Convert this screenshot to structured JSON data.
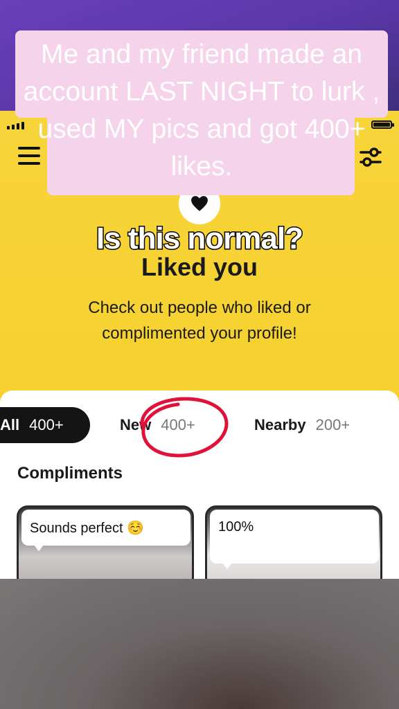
{
  "overlay": {
    "text": "Me and my friend made an account LAST NIGHT to lurk , used MY pics and got 400+ likes.",
    "caption": "Is this normal?"
  },
  "header": {
    "menu_icon": "hamburger-menu-icon",
    "filter_icon": "filter-sliders-icon",
    "badge_icon": "heart-icon"
  },
  "page": {
    "title": "Liked you",
    "subtitle": "Check out people who liked or complimented your profile!"
  },
  "tabs": [
    {
      "label": "All",
      "count": "400+"
    },
    {
      "label": "New",
      "count": "400+"
    },
    {
      "label": "Nearby",
      "count": "200+"
    }
  ],
  "compliments": {
    "title": "Compliments",
    "cards": [
      {
        "text": "Sounds perfect ☺️"
      },
      {
        "text": "100%"
      }
    ]
  },
  "colors": {
    "accent_yellow": "#f6d12f",
    "overlay_pink": "#f5d3ea",
    "annotation_red": "#e0123a",
    "active_tab": "#141414"
  }
}
